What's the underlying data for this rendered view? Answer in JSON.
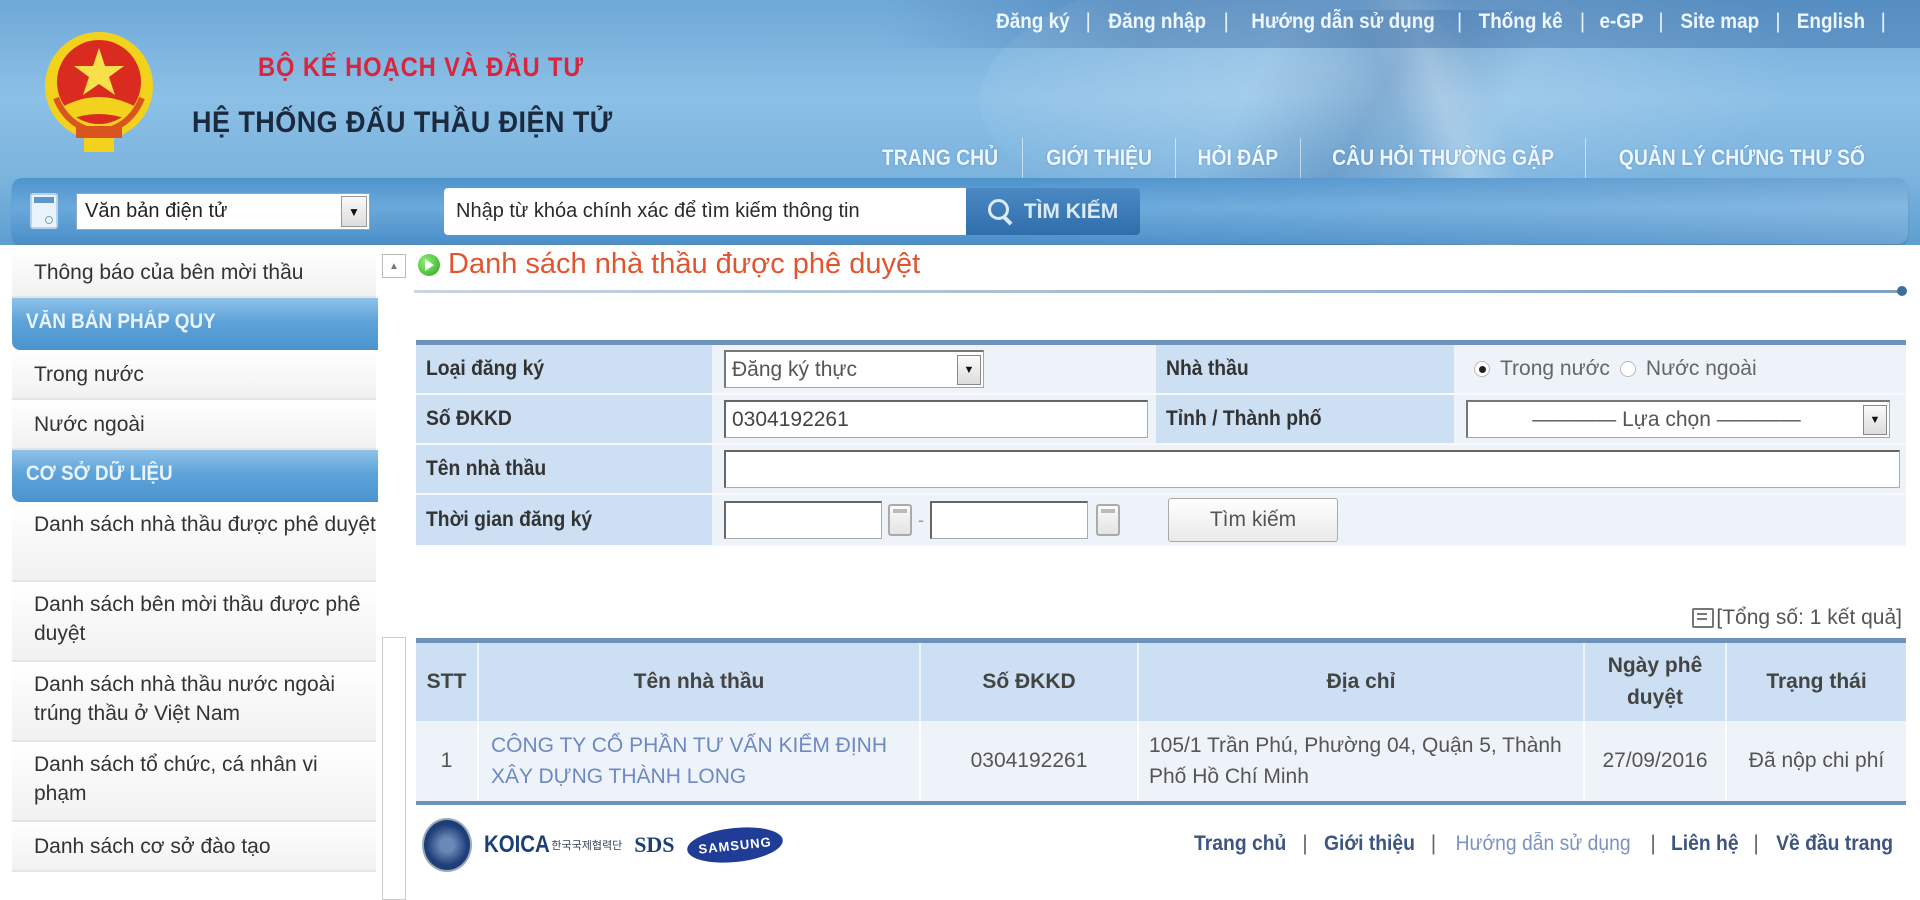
{
  "header": {
    "ministry_name": "BỘ KẾ HOẠCH VÀ ĐẦU TƯ",
    "system_name": "HỆ THỐNG ĐẤU THẦU ĐIỆN TỬ",
    "top_links": [
      "Đăng ký",
      "Đăng nhập",
      "Hướng dẫn sử dụng",
      "Thống kê",
      "e-GP",
      "Site map",
      "English"
    ],
    "top_link_separator": "|",
    "main_nav": [
      "TRANG CHỦ",
      "GIỚI THIỆU",
      "HỎI ĐÁP",
      "CÂU HỎI THƯỜNG GẶP",
      "QUẢN LÝ CHỨNG THƯ SỐ"
    ]
  },
  "search": {
    "category_selected": "Văn bản điện tử",
    "keyword_placeholder": "Nhập từ khóa chính xác để tìm kiếm thông tin",
    "button_label": "TÌM KIẾM"
  },
  "sidebar": {
    "top_item": "Thông báo của bên mời thầu",
    "sections": [
      {
        "header": "VĂN BẢN PHÁP QUY",
        "items": [
          "Trong nước",
          "Nước ngoài"
        ]
      },
      {
        "header": "CƠ SỞ DỮ LIỆU",
        "items": [
          "Danh sách nhà thầu được phê duyệt",
          "Danh sách bên mời thầu được phê duyệt",
          "Danh sách nhà thầu nước ngoài trúng thầu ở Việt Nam",
          "Danh sách tổ chức, cá nhân vi phạm",
          "Danh sách cơ sở đào tạo"
        ]
      }
    ]
  },
  "page": {
    "title": "Danh sách nhà thầu được phê duyệt",
    "accent_color": "#e0552f"
  },
  "filter": {
    "registration_type_label": "Loại đăng ký",
    "registration_type_value": "Đăng ký thực",
    "contractor_label": "Nhà thầu",
    "contractor_options": [
      "Trong nước",
      "Nước ngoài"
    ],
    "contractor_selected": "Trong nước",
    "business_reg_label": "Số ĐKKD",
    "business_reg_value": "0304192261",
    "province_label": "Tỉnh / Thành phố",
    "province_value": "———— Lựa chọn ————",
    "contractor_name_label": "Tên nhà thầu",
    "contractor_name_value": "",
    "reg_time_label": "Thời gian đăng ký",
    "date_from": "",
    "date_separator": "-",
    "date_to": "",
    "search_button": "Tìm kiếm"
  },
  "results": {
    "total_text": "[Tổng số: 1 kết quả]",
    "columns": [
      "STT",
      "Tên nhà thầu",
      "Số ĐKKD",
      "Địa chỉ",
      "Ngày phê duyệt",
      "Trạng thái"
    ],
    "rows": [
      {
        "stt": "1",
        "name": "CÔNG TY CỔ PHẦN TƯ VẤN KIỂM ĐỊNH XÂY DỰNG THÀNH LONG",
        "reg_no": "0304192261",
        "address": "105/1 Trần Phú, Phường 04, Quận 5, Thành Phố Hồ Chí Minh",
        "approved_date": "27/09/2016",
        "status": "Đã nộp chi phí"
      }
    ]
  },
  "footer": {
    "partners": [
      "KOICA",
      "한국국제협력단",
      "SDS",
      "SAMSUNG"
    ],
    "links": [
      "Trang chủ",
      "Giới thiệu",
      "Hướng dẫn sử dụng",
      "Liên hệ",
      "Về đầu trang"
    ],
    "separator": "|"
  }
}
